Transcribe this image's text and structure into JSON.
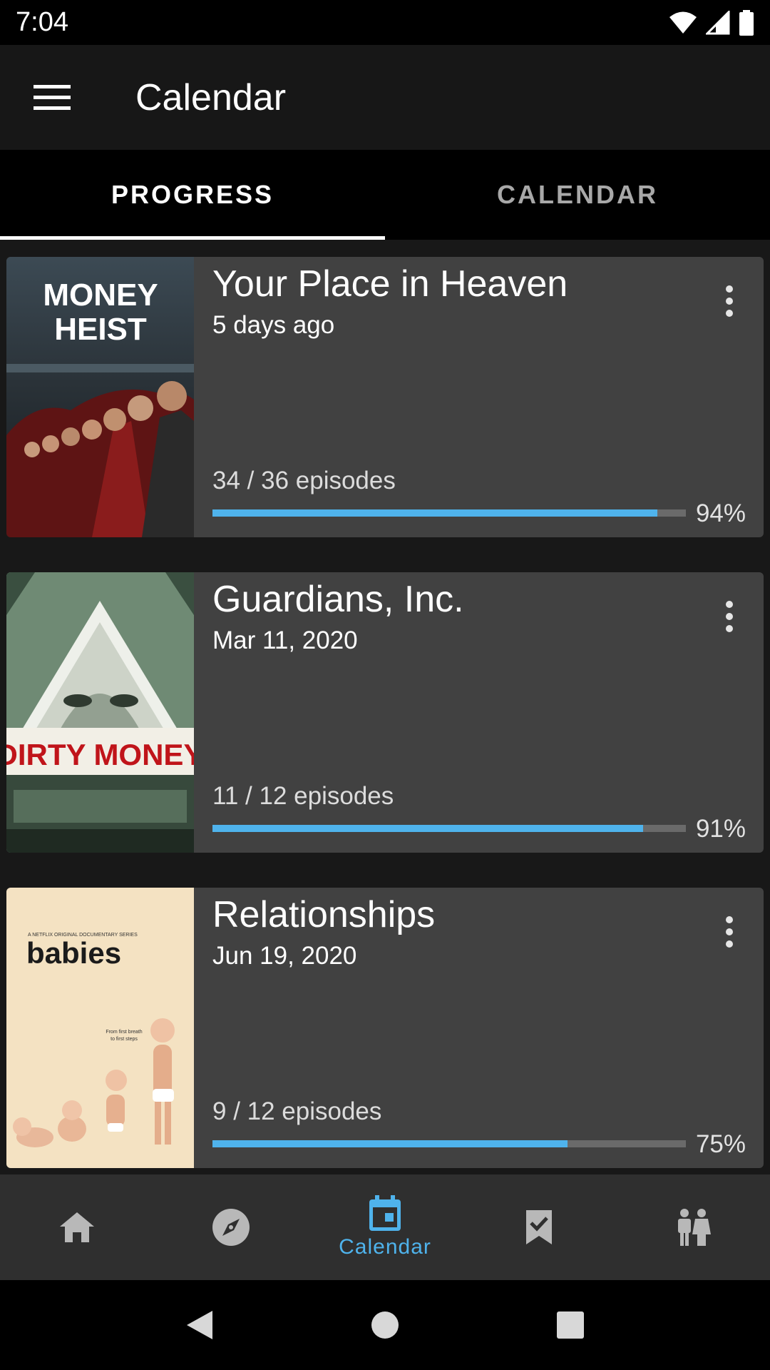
{
  "status_bar": {
    "time": "7:04"
  },
  "app_bar": {
    "title": "Calendar"
  },
  "tabs": [
    {
      "label": "PROGRESS",
      "active": true
    },
    {
      "label": "CALENDAR",
      "active": false
    }
  ],
  "shows": [
    {
      "poster_text": [
        "MONEY",
        "HEIST"
      ],
      "title": "Your Place in Heaven",
      "date": "5 days ago",
      "episodes": "34 / 36 episodes",
      "percent_label": "94%",
      "progress": 0.94
    },
    {
      "poster_text": [
        "DIRTY MONEY"
      ],
      "title": "Guardians, Inc.",
      "date": "Mar 11, 2020",
      "episodes": "11 / 12 episodes",
      "percent_label": "91%",
      "progress": 0.91
    },
    {
      "poster_text": [
        "A NETFLIX ORIGINAL DOCUMENTARY SERIES",
        "babies",
        "From first breath",
        "to first steps"
      ],
      "title": "Relationships",
      "date": "Jun 19, 2020",
      "episodes": "9 / 12 episodes",
      "percent_label": "75%",
      "progress": 0.75
    }
  ],
  "bottom_nav": {
    "items": [
      {
        "icon": "home-icon"
      },
      {
        "icon": "compass-icon"
      },
      {
        "icon": "calendar-icon",
        "label": "Calendar",
        "active": true
      },
      {
        "icon": "watchlist-icon"
      },
      {
        "icon": "people-icon"
      }
    ]
  },
  "colors": {
    "accent": "#4fb3ec",
    "card": "#414141",
    "background": "#181818"
  }
}
